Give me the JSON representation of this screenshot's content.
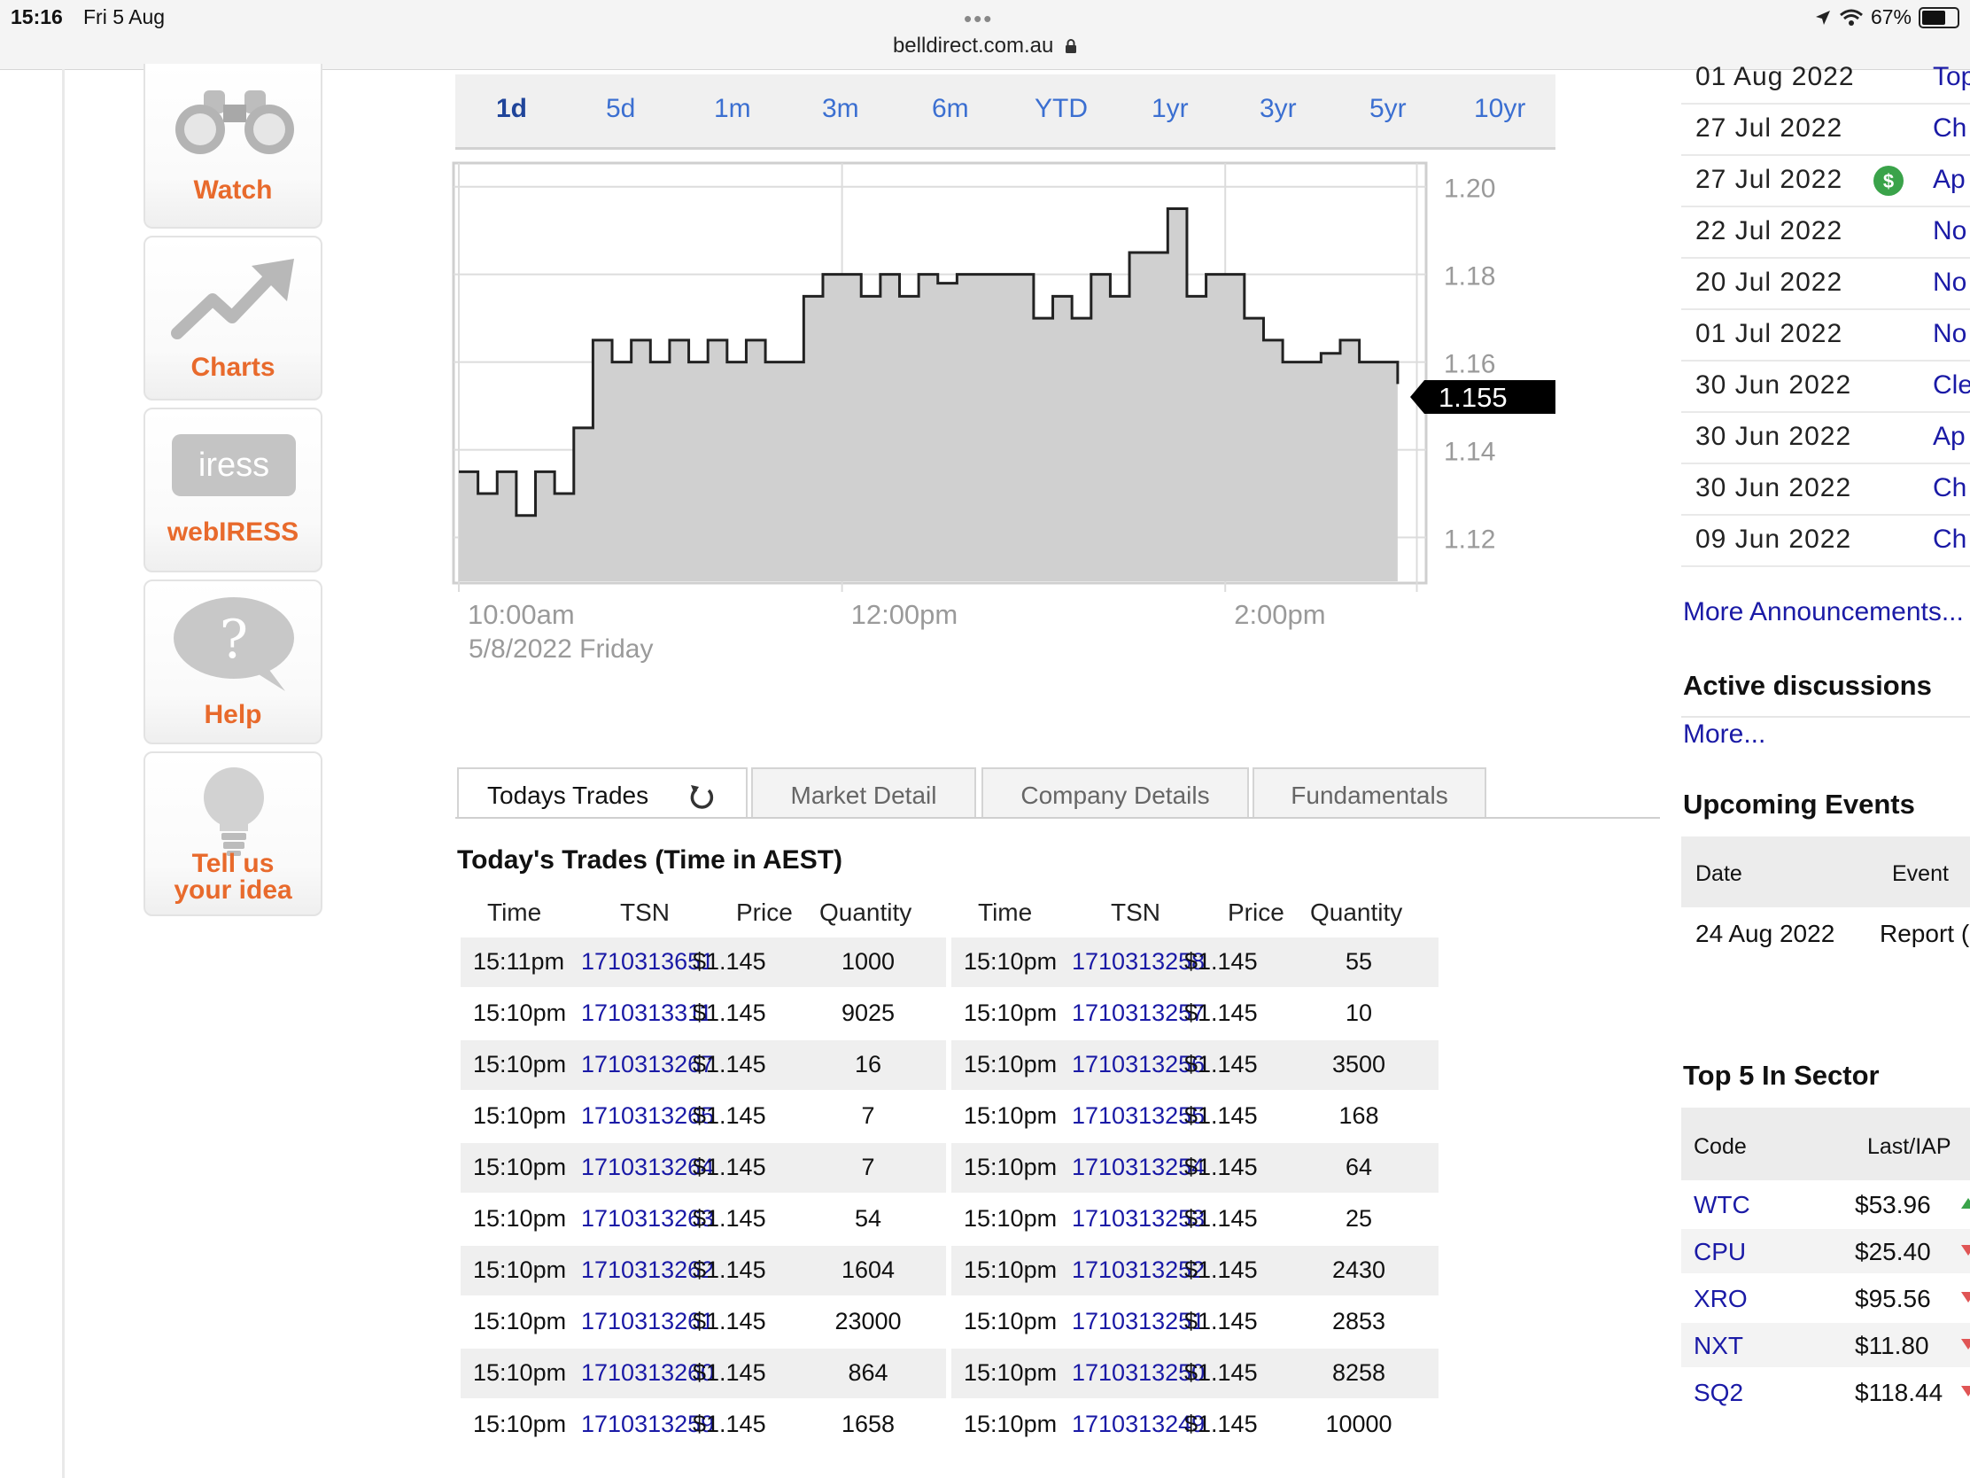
{
  "status_bar": {
    "time": "15:16",
    "date": "Fri 5 Aug",
    "url": "belldirect.com.au",
    "battery": "67%"
  },
  "left_nav": [
    {
      "label": "Watch",
      "icon": "binoculars-icon"
    },
    {
      "label": "Charts",
      "icon": "trend-arrow-icon"
    },
    {
      "label": "webIRESS",
      "badge": "iress",
      "icon": "iress-logo-icon"
    },
    {
      "label": "Help",
      "icon": "question-bubble-icon"
    },
    {
      "label": "Tell us\nyour idea",
      "label_line1": "Tell us",
      "label_line2": "your idea",
      "icon": "lightbulb-icon"
    }
  ],
  "range_tabs": [
    "1d",
    "5d",
    "1m",
    "3m",
    "6m",
    "YTD",
    "1yr",
    "3yr",
    "5yr",
    "10yr"
  ],
  "selected_range": "1d",
  "chart_data": {
    "type": "area",
    "x_tick_labels": [
      "10:00am",
      "12:00pm",
      "2:00pm"
    ],
    "date_label": "5/8/2022 Friday",
    "y_tick_labels": [
      "1.20",
      "1.18",
      "1.16",
      "1.14",
      "1.12"
    ],
    "ylim": [
      1.11,
      1.205
    ],
    "x_hours": [
      10.0,
      10.1,
      10.2,
      10.3,
      10.4,
      10.5,
      10.6,
      10.7,
      10.8,
      10.9,
      11.0,
      11.1,
      11.2,
      11.3,
      11.4,
      11.5,
      11.6,
      11.7,
      11.8,
      11.9,
      12.0,
      12.1,
      12.2,
      12.3,
      12.4,
      12.5,
      12.6,
      12.7,
      12.8,
      12.9,
      13.0,
      13.1,
      13.2,
      13.3,
      13.4,
      13.5,
      13.6,
      13.7,
      13.8,
      13.9,
      14.0,
      14.1,
      14.2,
      14.3,
      14.4,
      14.5,
      14.6,
      14.7,
      14.8,
      14.9
    ],
    "values": [
      1.135,
      1.13,
      1.135,
      1.125,
      1.135,
      1.13,
      1.145,
      1.165,
      1.16,
      1.165,
      1.16,
      1.165,
      1.16,
      1.165,
      1.16,
      1.165,
      1.16,
      1.16,
      1.175,
      1.18,
      1.18,
      1.175,
      1.18,
      1.175,
      1.18,
      1.178,
      1.18,
      1.18,
      1.18,
      1.18,
      1.17,
      1.175,
      1.17,
      1.18,
      1.175,
      1.185,
      1.185,
      1.195,
      1.175,
      1.18,
      1.18,
      1.17,
      1.165,
      1.16,
      1.16,
      1.162,
      1.165,
      1.16,
      1.16,
      1.155
    ],
    "last_price": "1.155",
    "grid": true
  },
  "detail_tabs": [
    "Todays Trades",
    "Market Detail",
    "Company Details",
    "Fundamentals"
  ],
  "trades": {
    "title": "Today's Trades (Time in AEST)",
    "headers": [
      "Time",
      "TSN",
      "Price",
      "Quantity"
    ],
    "left": [
      [
        "15:11pm",
        "1710313651",
        "$1.145",
        "1000"
      ],
      [
        "15:10pm",
        "1710313311",
        "$1.145",
        "9025"
      ],
      [
        "15:10pm",
        "1710313267",
        "$1.145",
        "16"
      ],
      [
        "15:10pm",
        "1710313265",
        "$1.145",
        "7"
      ],
      [
        "15:10pm",
        "1710313264",
        "$1.145",
        "7"
      ],
      [
        "15:10pm",
        "1710313263",
        "$1.145",
        "54"
      ],
      [
        "15:10pm",
        "1710313262",
        "$1.145",
        "1604"
      ],
      [
        "15:10pm",
        "1710313261",
        "$1.145",
        "23000"
      ],
      [
        "15:10pm",
        "1710313260",
        "$1.145",
        "864"
      ],
      [
        "15:10pm",
        "1710313259",
        "$1.145",
        "1658"
      ]
    ],
    "right": [
      [
        "15:10pm",
        "1710313258",
        "$1.145",
        "55"
      ],
      [
        "15:10pm",
        "1710313257",
        "$1.145",
        "10"
      ],
      [
        "15:10pm",
        "1710313256",
        "$1.145",
        "3500"
      ],
      [
        "15:10pm",
        "1710313255",
        "$1.145",
        "168"
      ],
      [
        "15:10pm",
        "1710313254",
        "$1.145",
        "64"
      ],
      [
        "15:10pm",
        "1710313253",
        "$1.145",
        "25"
      ],
      [
        "15:10pm",
        "1710313252",
        "$1.145",
        "2430"
      ],
      [
        "15:10pm",
        "1710313251",
        "$1.145",
        "2853"
      ],
      [
        "15:10pm",
        "1710313250",
        "$1.145",
        "8258"
      ],
      [
        "15:10pm",
        "1710313249",
        "$1.145",
        "10000"
      ]
    ]
  },
  "announcements": [
    {
      "date": "01 Aug 2022",
      "title": "Top"
    },
    {
      "date": "27 Jul 2022",
      "title": "Ch"
    },
    {
      "date": "27 Jul 2022",
      "title": "Ap",
      "price_sensitive": true
    },
    {
      "date": "22 Jul 2022",
      "title": "No"
    },
    {
      "date": "20 Jul 2022",
      "title": "No"
    },
    {
      "date": "01 Jul 2022",
      "title": "No"
    },
    {
      "date": "30 Jun 2022",
      "title": "Cle"
    },
    {
      "date": "30 Jun 2022",
      "title": "Ap"
    },
    {
      "date": "30 Jun 2022",
      "title": "Ch"
    },
    {
      "date": "09 Jun 2022",
      "title": "Ch"
    }
  ],
  "more_announcements": "More Announcements...",
  "active_discussions": {
    "heading": "Active discussions",
    "more": "More..."
  },
  "upcoming_events": {
    "heading": "Upcoming Events",
    "headers": [
      "Date",
      "Event"
    ],
    "rows": [
      [
        "24 Aug 2022",
        "Report ("
      ]
    ]
  },
  "top5": {
    "heading": "Top 5 In Sector",
    "headers": [
      "Code",
      "Last/IAP"
    ],
    "rows": [
      {
        "code": "WTC",
        "last": "$53.96",
        "dir": "up"
      },
      {
        "code": "CPU",
        "last": "$25.40",
        "dir": "down"
      },
      {
        "code": "XRO",
        "last": "$95.56",
        "dir": "down"
      },
      {
        "code": "NXT",
        "last": "$11.80",
        "dir": "down"
      },
      {
        "code": "SQ2",
        "last": "$118.44",
        "dir": "down"
      }
    ]
  },
  "colors": {
    "link": "#1a1aa6",
    "range_tab": "#3b6fd1",
    "nav_label": "#e86a2c",
    "area_fill": "#d0d0d0"
  }
}
